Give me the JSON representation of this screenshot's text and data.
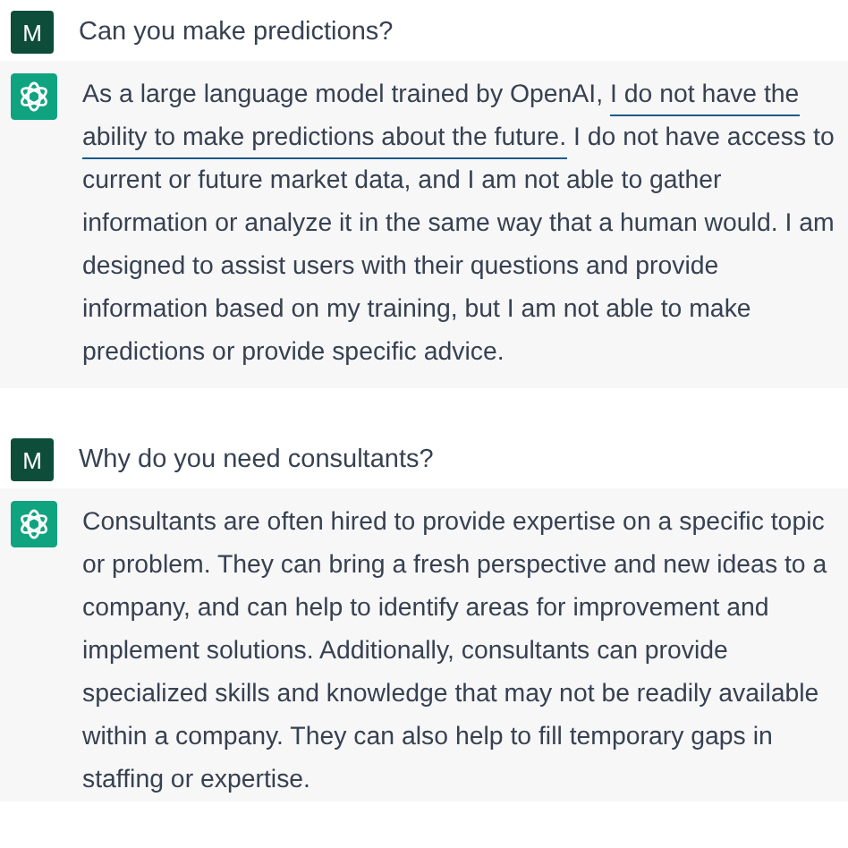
{
  "exchanges": [
    {
      "user": {
        "initial": "M",
        "text": "Can you make predictions?"
      },
      "answer": [
        {
          "text": "As a large language model trained by OpenAI, ",
          "highlighted": false
        },
        {
          "text": "I do not have the ability to make predictions about the future.",
          "highlighted": true
        },
        {
          "text": " I do not have access to current or future market data, and I am not able to gather information or analyze it in the same way that a human would. I am designed to assist users with their questions and provide information based on my training, but I am not able to make predictions or provide specific advice.",
          "highlighted": false
        }
      ]
    },
    {
      "user": {
        "initial": "M",
        "text": "Why do you need consultants?"
      },
      "answer": [
        {
          "text": "Consultants are often hired to provide expertise on a specific topic or problem. They can bring a fresh perspective and new ideas to a company, and can help to identify areas for improvement and implement solutions. Additionally, consultants can provide specialized skills and knowledge that may not be readily available within a company. They can also help to fill temporary gaps in staffing or expertise.",
          "highlighted": false
        }
      ]
    }
  ]
}
